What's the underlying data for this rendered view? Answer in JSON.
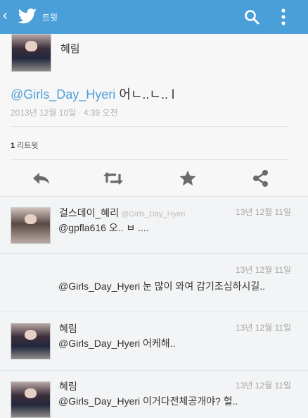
{
  "header": {
    "title": "트윗"
  },
  "tweet": {
    "author": "혜림",
    "mention": "@Girls_Day_Hyeri",
    "body": " 어ㄴ..ㄴ.. l",
    "date": "2013년 12월 10일 · 4:39 오전",
    "retweet_count": "1",
    "retweet_label": "리트윗"
  },
  "actions": [
    "reply-icon",
    "retweet-icon",
    "favorite-icon",
    "share-icon"
  ],
  "replies": [
    {
      "name": "걸스데이_혜리",
      "handle": "@Girls_Day_Hyeri",
      "time": "13년 12월 11일",
      "mention": "",
      "text": "@gpfla616 오.. ㅂ ...."
    },
    {
      "name": "",
      "handle": "",
      "time": "13년 12월 11일",
      "mention": "@Girls_Day_Hyeri",
      "text": " 눈 많이 와여 감기조심하시길.."
    },
    {
      "name": "혜림",
      "handle": "",
      "time": "13년 12월 11일",
      "mention": "@Girls_Day_Hyeri",
      "text": " 어케해.."
    },
    {
      "name": "혜림",
      "handle": "",
      "time": "13년 12월 11일",
      "mention": "@Girls_Day_Hyeri",
      "text": " 이거다전체공개야? 헐.."
    }
  ],
  "colors": {
    "header": "#4b9fd8",
    "mention": "#4fa0d6",
    "background": "#f3f4f5"
  }
}
